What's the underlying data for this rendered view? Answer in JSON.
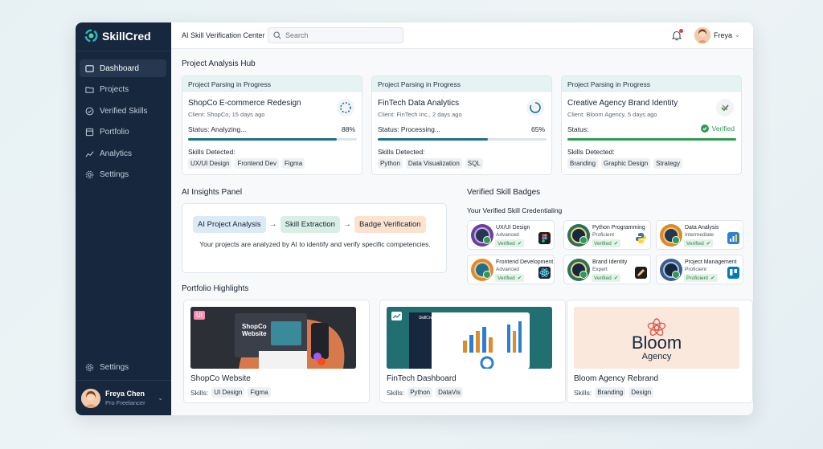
{
  "brand": {
    "name": "SkillCred"
  },
  "sidebar": {
    "items": [
      {
        "label": "Dashboard",
        "icon": "dashboard-icon"
      },
      {
        "label": "Projects",
        "icon": "folder-icon"
      },
      {
        "label": "Verified Skills",
        "icon": "check-circle-icon"
      },
      {
        "label": "Portfolio",
        "icon": "portfolio-icon"
      },
      {
        "label": "Analytics",
        "icon": "chart-line-icon"
      },
      {
        "label": "Settings",
        "icon": "gear-icon"
      }
    ],
    "bottom_settings": "Settings",
    "profile": {
      "name": "Freya Chen",
      "role": "Pro Freelancer"
    }
  },
  "topbar": {
    "title": "AI Skill Verification Center",
    "search_placeholder": "Search",
    "user_name": "Freya"
  },
  "hub": {
    "title": "Project Analysis Hub",
    "cards": [
      {
        "header": "Project Parsing in Progress",
        "title": "ShopCo E-commerce Redesign",
        "client": "Client: ShopCo, 15 days ago",
        "status": "Status: Analyzing...",
        "percent": "88%",
        "progress": 0.88,
        "skills_label": "Skills Detected:",
        "skills": [
          "UX/UI Design",
          "Frontend Dev",
          "Figma"
        ]
      },
      {
        "header": "Project Parsing in Progress",
        "title": "FinTech Data Analytics",
        "client": "Client: FinTech Inc., 2 days ago",
        "status": "Status: Processing...",
        "percent": "65%",
        "progress": 0.65,
        "skills_label": "Skills Detected:",
        "skills": [
          "Python",
          "Data Visualization",
          "SQL"
        ]
      },
      {
        "header": "Project Parsing in Progress",
        "title": "Creative Agency Brand Identity",
        "client": "Client: Bloom Agency, 5 days ago",
        "status": "Status:",
        "verified_label": "Verified",
        "progress": 1.0,
        "skills_label": "Skills Detected:",
        "skills": [
          "Branding",
          "Graphic Design",
          "Strategy"
        ]
      }
    ]
  },
  "ai_insights": {
    "title": "AI Insights Panel",
    "steps": [
      "AI Project Analysis",
      "Skill Extraction",
      "Badge Verification"
    ],
    "arrow": "→",
    "description": "Your projects are analyzed by AI to identify and verify specific competencies."
  },
  "badges": {
    "title": "Verified Skill Badges",
    "subtitle": "Your Verified Skill Credentialing",
    "items": [
      {
        "name": "UX/UI Design",
        "level": "Advanced",
        "tag": "Verified",
        "icon": "figma-icon"
      },
      {
        "name": "Python Programming",
        "level": "Proficient",
        "tag": "Verified",
        "icon": "python-icon"
      },
      {
        "name": "Data Analysis",
        "level": "Intermediate",
        "tag": "Verified",
        "icon": "bar-chart-icon"
      },
      {
        "name": "Frontend Development",
        "level": "Advanced",
        "tag": "Verified",
        "icon": "react-icon"
      },
      {
        "name": "Brand Identity",
        "level": "Expert",
        "tag": "Verified",
        "icon": "pen-icon"
      },
      {
        "name": "Project Management",
        "level": "Proficient",
        "tag": "Proficient",
        "icon": "trello-icon"
      }
    ]
  },
  "portfolio": {
    "title": "Portfolio Highlights",
    "skills_label": "Skills:",
    "items": [
      {
        "title": "ShopCo Website",
        "skills": [
          "UI Design",
          "Figma"
        ],
        "badge": "UI",
        "mock_title": "ShopCo Website"
      },
      {
        "title": "FinTech Dashboard",
        "skills": [
          "Python",
          "DataVis"
        ],
        "mock_brand": "SkillCred"
      },
      {
        "title": "Bloom Agency Rebrand",
        "skills": [
          "Branding",
          "Design"
        ],
        "logo_name": "Bloom",
        "logo_sub": "Agency"
      }
    ]
  },
  "colors": {
    "sidebar_bg": "#17273d",
    "accent_teal": "#1f6e8c",
    "verified_green": "#2f9a53"
  }
}
